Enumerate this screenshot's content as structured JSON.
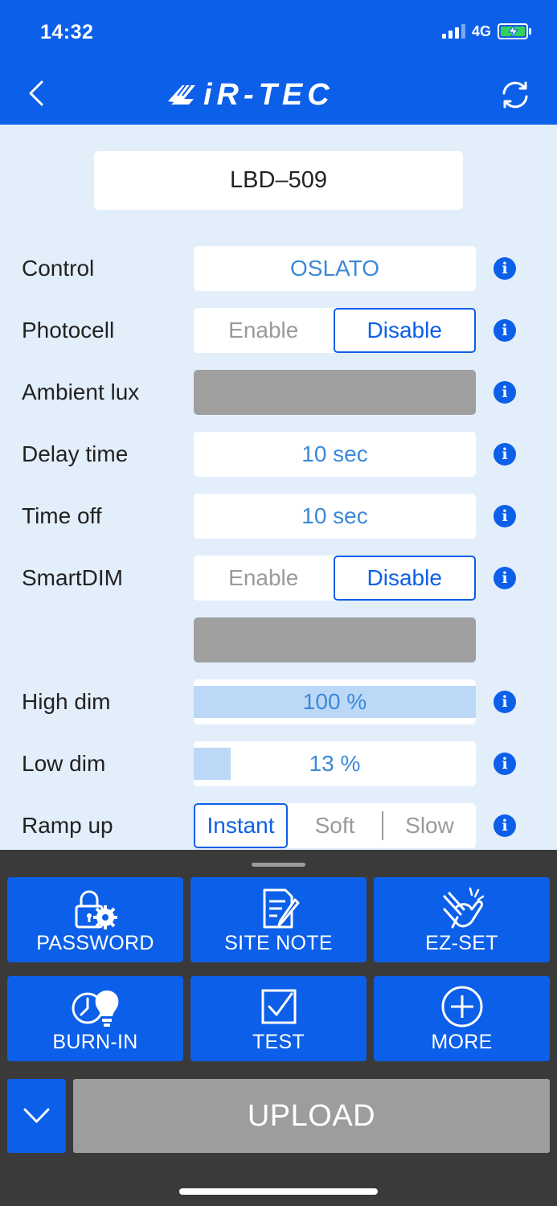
{
  "status": {
    "time": "14:32",
    "network": "4G"
  },
  "header": {
    "logo_text": "iR-TEC",
    "back_icon": "chevron-left-icon",
    "refresh_icon": "refresh-icon"
  },
  "device": {
    "name": "LBD–509"
  },
  "settings": {
    "control": {
      "label": "Control",
      "value": "OSLATO"
    },
    "photocell": {
      "label": "Photocell",
      "options": [
        "Enable",
        "Disable"
      ],
      "selected": "Disable"
    },
    "ambient_lux": {
      "label": "Ambient lux"
    },
    "delay_time": {
      "label": "Delay time",
      "value": "10 sec"
    },
    "time_off": {
      "label": "Time off",
      "value": "10 sec"
    },
    "smartdim": {
      "label": "SmartDIM",
      "options": [
        "Enable",
        "Disable"
      ],
      "selected": "Disable"
    },
    "high_dim": {
      "label": "High dim",
      "value": "100 %",
      "level": 1.0
    },
    "low_dim": {
      "label": "Low dim",
      "value": "13 %",
      "level": 0.13
    },
    "ramp_up": {
      "label": "Ramp up",
      "options": [
        "Instant",
        "Soft",
        "Slow"
      ],
      "selected": "Instant"
    }
  },
  "actions": [
    {
      "label": "PASSWORD",
      "icon": "lock-gear-icon"
    },
    {
      "label": "SITE NOTE",
      "icon": "note-pen-icon"
    },
    {
      "label": "EZ-SET",
      "icon": "pointing-hand-icon"
    },
    {
      "label": "BURN-IN",
      "icon": "clock-bulb-icon"
    },
    {
      "label": "TEST",
      "icon": "checkbox-icon"
    },
    {
      "label": "MORE",
      "icon": "plus-circle-icon"
    }
  ],
  "bottom": {
    "upload_label": "UPLOAD",
    "collapse_icon": "chevron-down-icon"
  },
  "colors": {
    "primary": "#0c5fe8",
    "accent_text": "#3c89d8",
    "background": "#e3eefb",
    "disabled": "#9f9f9f"
  }
}
